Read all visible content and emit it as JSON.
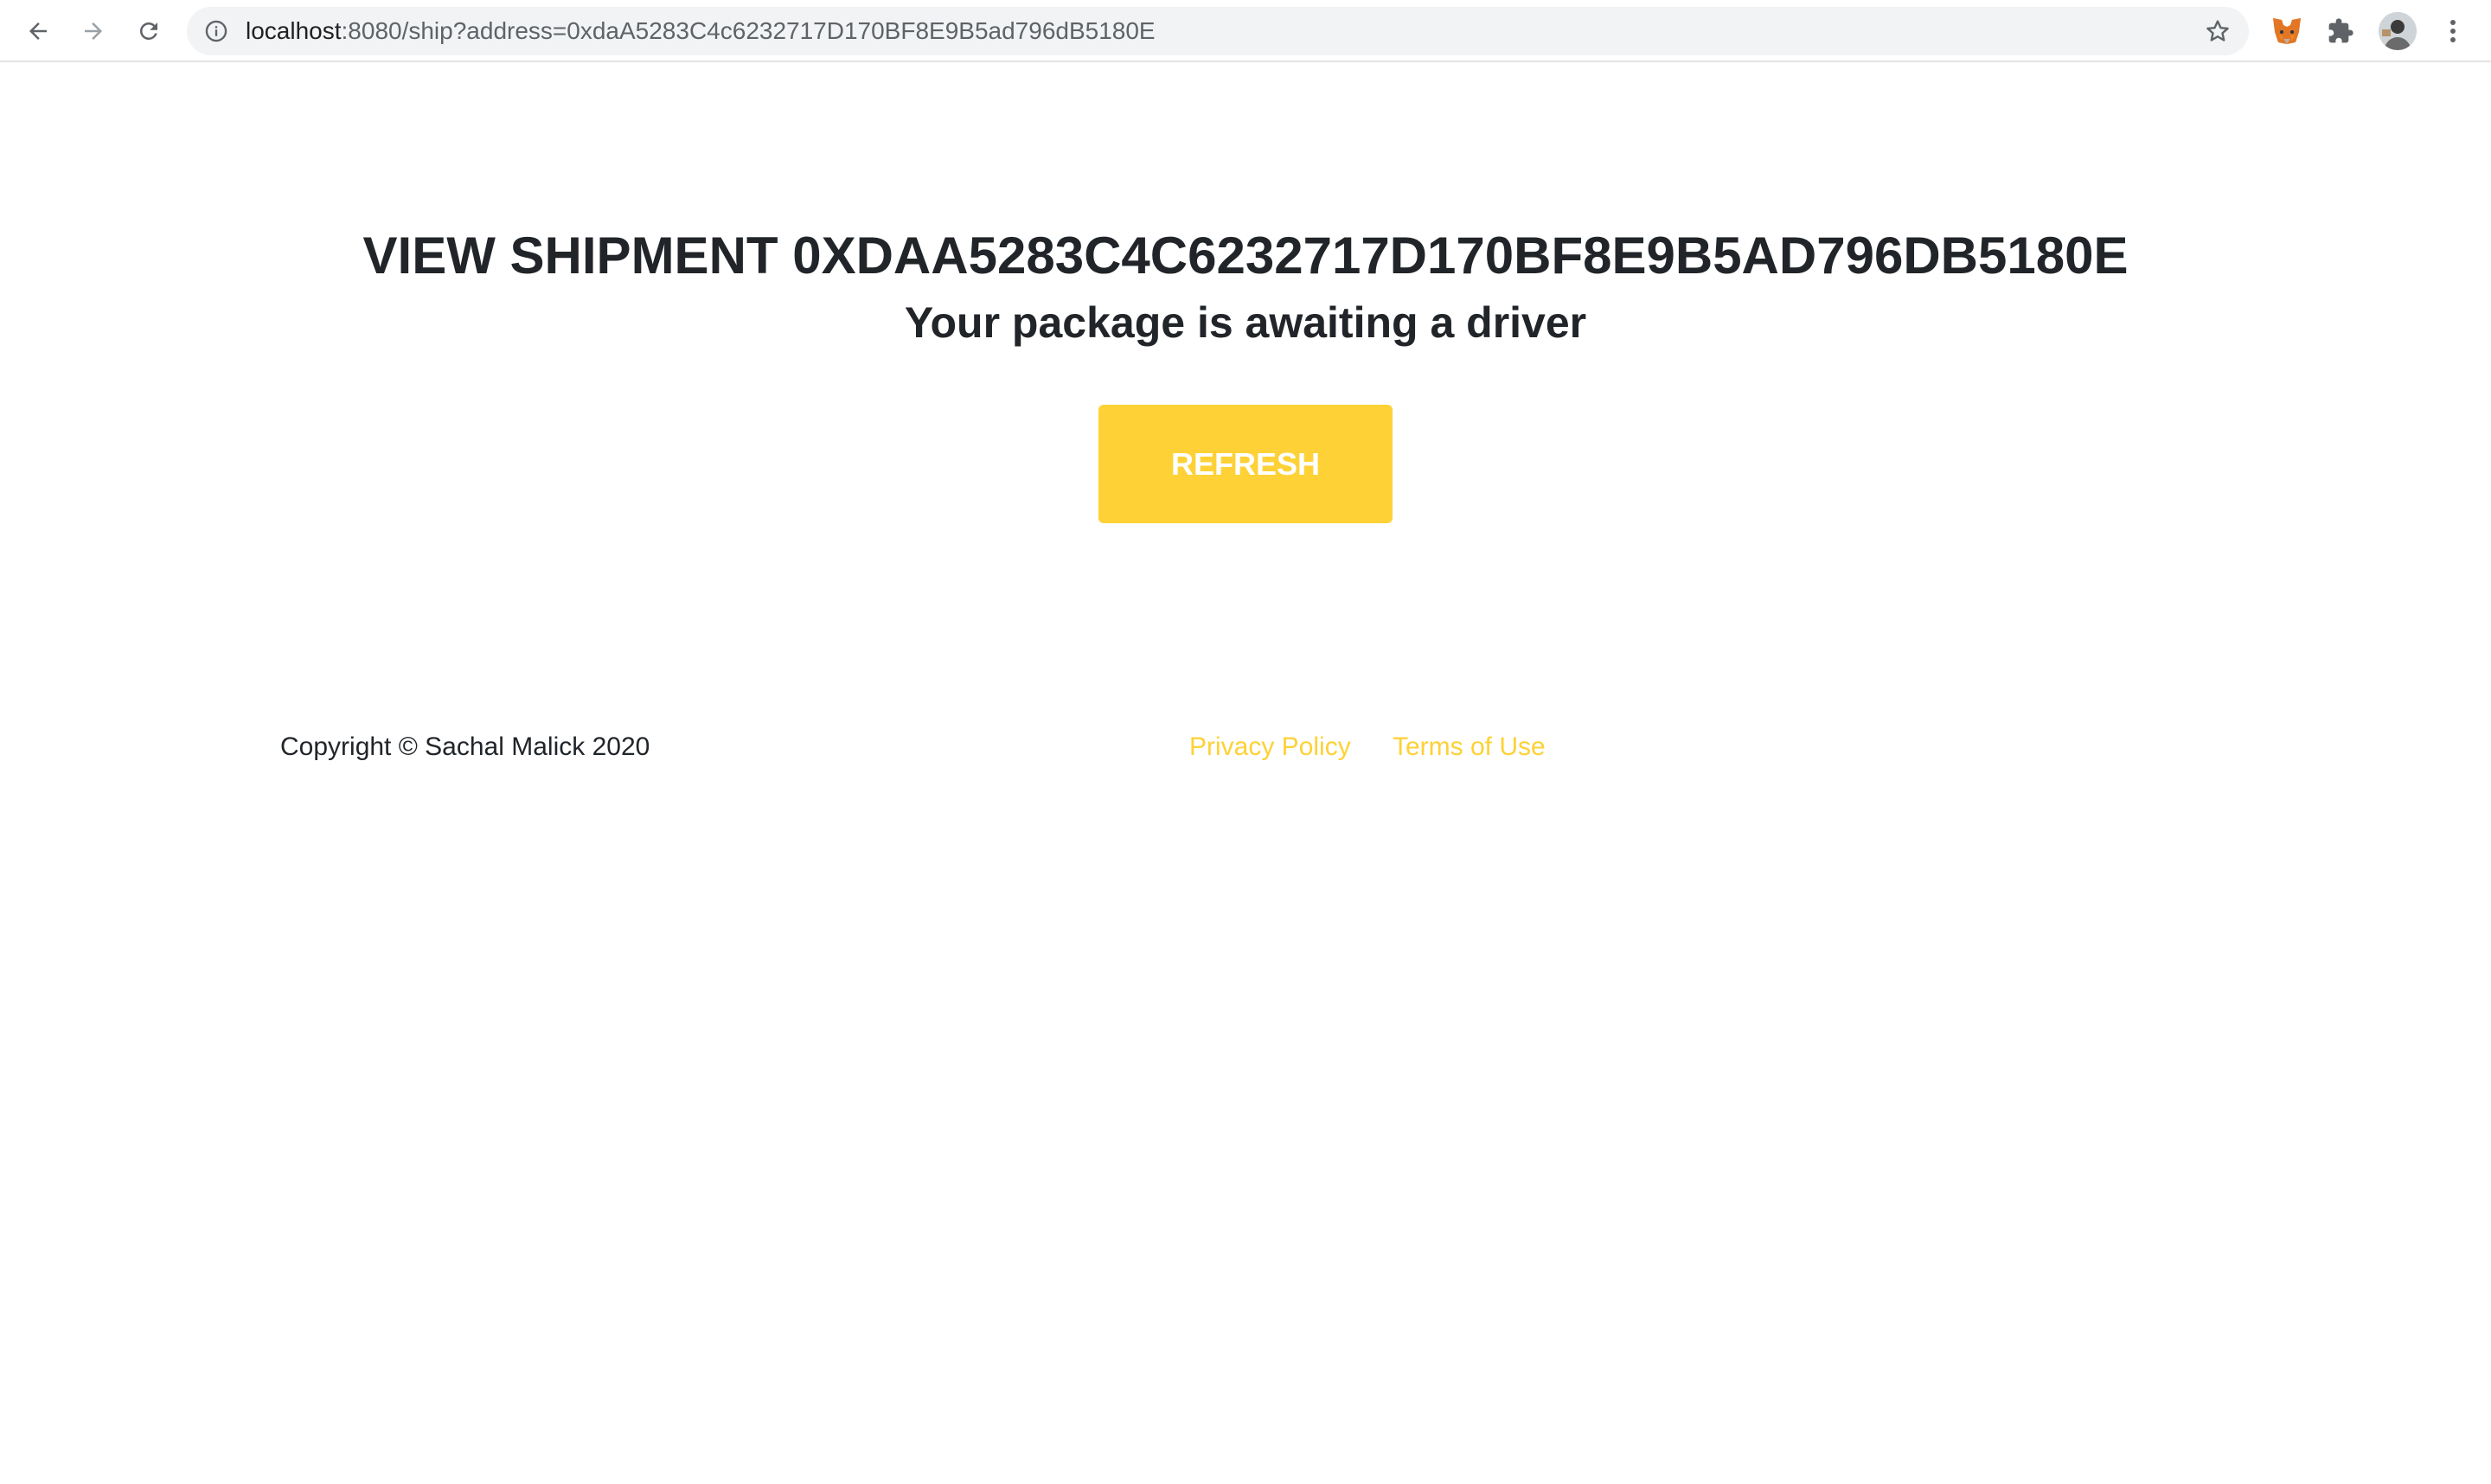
{
  "browser": {
    "url_host": "localhost",
    "url_rest": ":8080/ship?address=0xdaA5283C4c6232717D170BF8E9B5ad796dB5180E",
    "icons": {
      "back": "arrow-left-icon",
      "forward": "arrow-right-icon",
      "reload": "reload-icon",
      "site_info": "info-icon",
      "bookmark": "star-icon",
      "metamask": "metamask-fox-icon",
      "extensions": "puzzle-icon",
      "profile": "avatar",
      "menu": "kebab-menu-icon"
    }
  },
  "page": {
    "title": "VIEW SHIPMENT 0XDAA5283C4C6232717D170BF8E9B5AD796DB5180E",
    "status": "Your package is awaiting a driver",
    "refresh_label": "REFRESH"
  },
  "footer": {
    "copyright": "Copyright © Sachal Malick 2020",
    "privacy_label": "Privacy Policy",
    "terms_label": "Terms of Use"
  },
  "colors": {
    "accent": "#fed136",
    "text": "#212529",
    "background": "#ffffff"
  }
}
